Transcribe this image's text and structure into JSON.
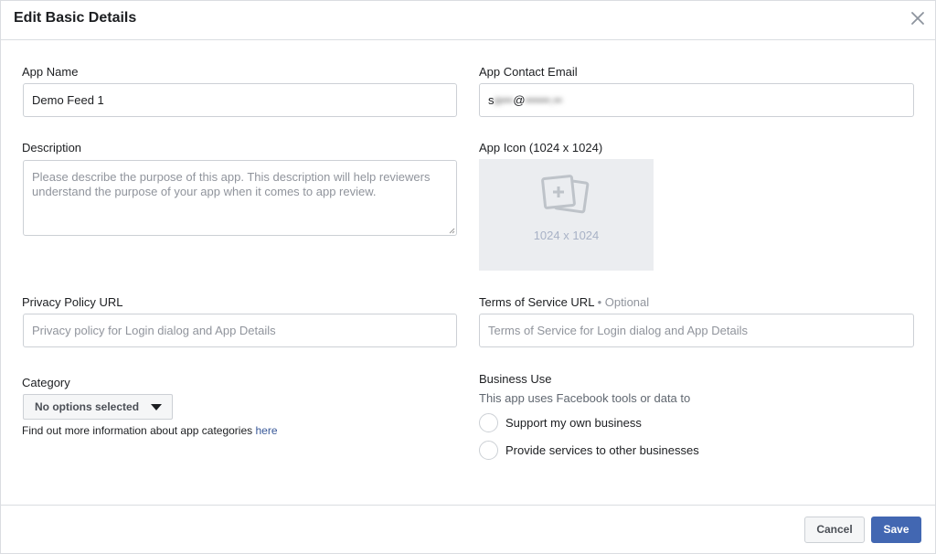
{
  "dialog": {
    "title": "Edit Basic Details"
  },
  "app_name": {
    "label": "App Name",
    "value": "Demo Feed 1"
  },
  "contact_email": {
    "label": "App Contact Email",
    "prefix": "s",
    "blurred_user": "a•••",
    "at": "@",
    "blurred_domain": "••••••.••"
  },
  "description": {
    "label": "Description",
    "placeholder": "Please describe the purpose of this app. This description will help reviewers understand the purpose of your app when it comes to app review."
  },
  "app_icon": {
    "label": "App Icon (1024 x 1024)",
    "size_text": "1024 x 1024"
  },
  "privacy_policy": {
    "label": "Privacy Policy URL",
    "placeholder": "Privacy policy for Login dialog and App Details"
  },
  "terms_of_service": {
    "label": "Terms of Service URL",
    "optional": "• Optional",
    "placeholder": "Terms of Service for Login dialog and App Details"
  },
  "category": {
    "label": "Category",
    "selected": "No options selected",
    "help_text": "Find out more information about app categories",
    "help_link": "here"
  },
  "business_use": {
    "label": "Business Use",
    "subtitle": "This app uses Facebook tools or data to",
    "options": [
      {
        "label": "Support my own business"
      },
      {
        "label": "Provide services to other businesses"
      }
    ]
  },
  "footer": {
    "cancel_label": "Cancel",
    "save_label": "Save"
  },
  "colors": {
    "primary": "#4267b2",
    "link": "#385898",
    "border": "#ccd0d5",
    "placeholder": "#90949c"
  }
}
